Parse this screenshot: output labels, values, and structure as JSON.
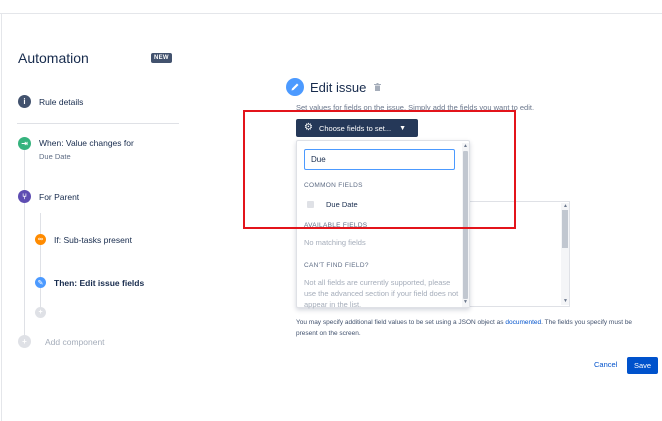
{
  "sidebar": {
    "title": "Automation",
    "badge": "NEW",
    "items": [
      {
        "label": "Rule details",
        "icon": "info-icon",
        "color": "#42526e"
      },
      {
        "label": "When: Value changes for",
        "sublabel": "Due Date",
        "icon": "trigger-icon",
        "color": "#36b37e"
      },
      {
        "label": "For Parent",
        "icon": "branch-icon",
        "color": "#5e4db2"
      },
      {
        "label": "If: Sub-tasks present",
        "icon": "condition-icon",
        "color": "#ff8b00"
      },
      {
        "label": "Then: Edit issue fields",
        "icon": "pencil-icon",
        "color": "#4c9aff"
      }
    ],
    "add_component": "Add component"
  },
  "main": {
    "title": "Edit issue",
    "description": "Set values for fields on the issue. Simply add the fields you want to edit.",
    "choose_button": "Choose fields to set...",
    "dropdown": {
      "search_value": "Due",
      "common_header": "COMMON FIELDS",
      "common_items": [
        "Due Date"
      ],
      "available_header": "AVAILABLE FIELDS",
      "no_match": "No matching fields",
      "cant_find_header": "CAN'T FIND FIELD?",
      "cant_find_text": "Not all fields are currently supported, please use the advanced section if your field does not appear in the list."
    },
    "help_prefix": "You may specify additional field values to be set using a JSON object as",
    "help_link": "documented",
    "help_suffix": ". The fields you specify must be present on the screen.",
    "cancel": "Cancel",
    "save": "Save"
  },
  "colors": {
    "primary": "#0052cc",
    "button_dark": "#253858",
    "highlight": "#e3141b"
  }
}
